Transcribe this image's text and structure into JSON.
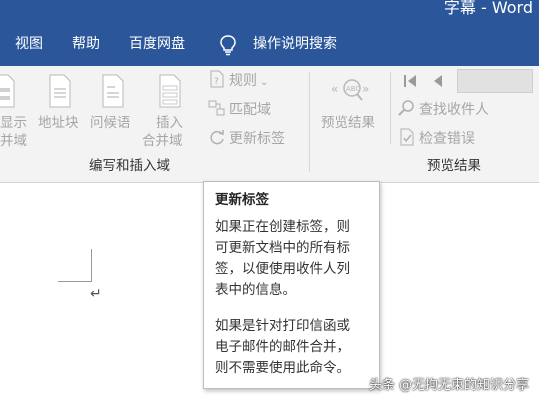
{
  "titlebar": {
    "title": "字幕 - Word"
  },
  "menu": {
    "items": [
      "视图",
      "帮助",
      "百度网盘"
    ],
    "tell_me": "操作说明搜索"
  },
  "ribbon": {
    "write_insert": {
      "buttons": {
        "highlight_fields": [
          "显示",
          "并域"
        ],
        "address_block": "地址块",
        "greeting_line": "问候语",
        "insert_merge_field": [
          "插入",
          "合并域"
        ]
      },
      "small_buttons": {
        "rules": "规则",
        "match_fields": "匹配域",
        "update_labels": "更新标签"
      },
      "group_label": "编写和插入域"
    },
    "preview": {
      "preview_results": "预览结果",
      "find_recipient": "查找收件人",
      "check_errors": "检查错误",
      "group_label": "预览结果"
    }
  },
  "tooltip": {
    "title": "更新标签",
    "lines": [
      "如果正在创建标签，则",
      "可更新文档中的所有标",
      "签，以便使用收件人列",
      "表中的信息。",
      "",
      "如果是针对打印信函或",
      "电子邮件的邮件合并，",
      "则不需要使用此命令。"
    ]
  },
  "watermark": "头条 @无拘无束的知识分享",
  "colors": {
    "title_bar": "#2b579a",
    "ribbon_bg": "#f3f3f3",
    "disabled_text": "#a6a6a6"
  }
}
